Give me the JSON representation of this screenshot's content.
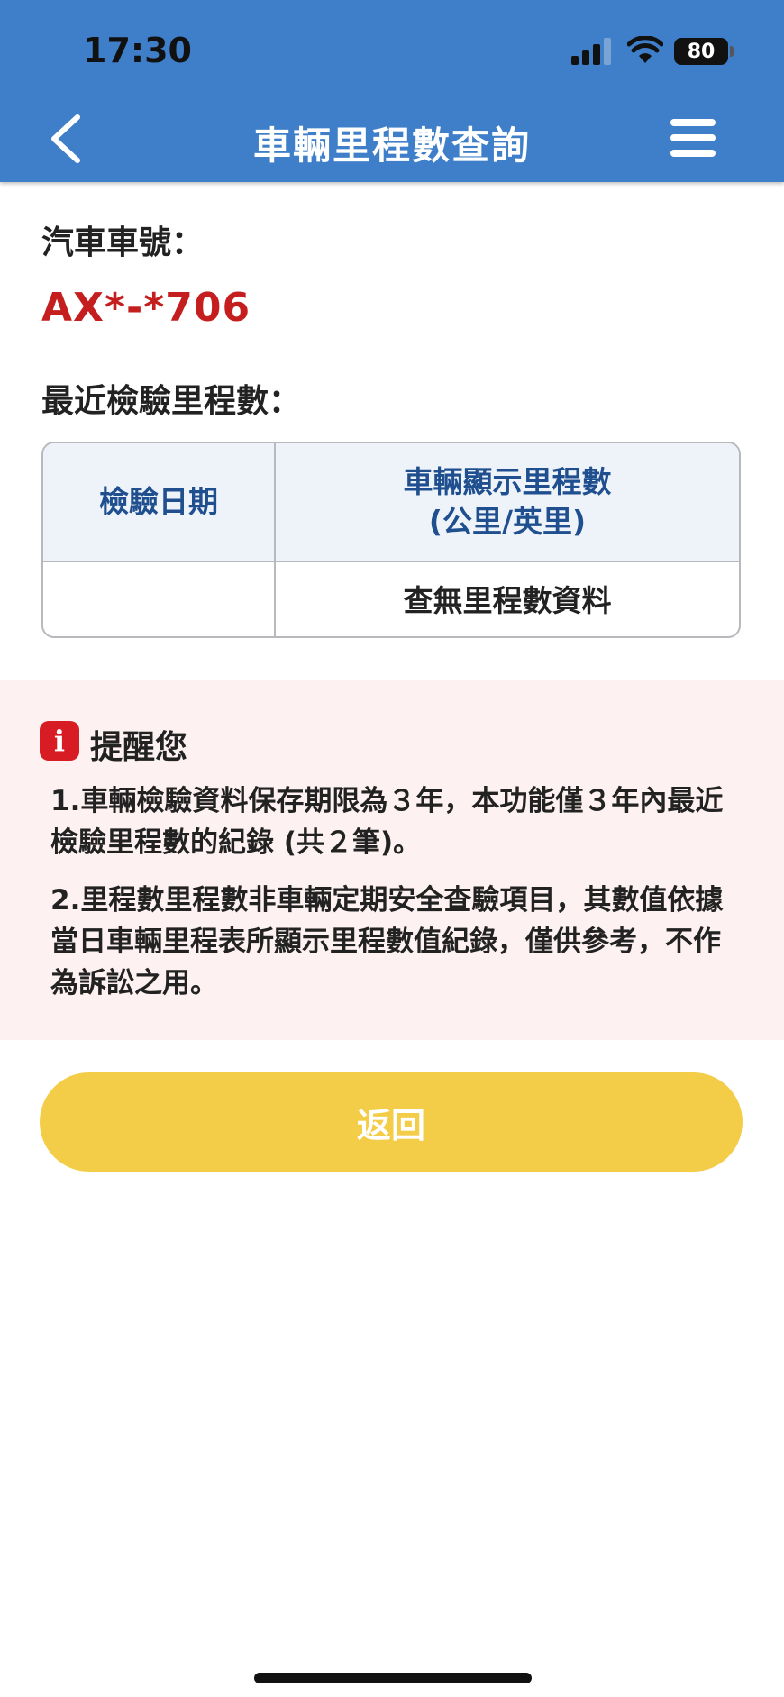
{
  "status_bar": {
    "time": "17:30",
    "battery": "80"
  },
  "header": {
    "title": "車輛里程數查詢"
  },
  "vehicle": {
    "plate_label": "汽車車號：",
    "plate": "AX*-*706"
  },
  "mileage": {
    "section_label": "最近檢驗里程數：",
    "columns": [
      {
        "line1": "檢驗日期"
      },
      {
        "line1": "車輛顯示里程數",
        "line2": "(公里/英里)"
      }
    ],
    "rows": [
      {
        "date": "",
        "mileage": "查無里程數資料"
      }
    ]
  },
  "reminder": {
    "title": "提醒您",
    "notes": [
      "1.車輛檢驗資料保存期限為３年，本功能僅３年內最近檢驗里程數的紀錄 (共２筆)。",
      "2.里程數里程數非車輛定期安全查驗項目，其數值依據當日車輛里程表所顯示里程數值紀錄，僅供參考，不作為訴訟之用。"
    ]
  },
  "actions": {
    "return_label": "返回"
  },
  "colors": {
    "header_bg": "#3f7fc9",
    "plate": "#c41e1e",
    "button": "#f4cd48",
    "reminder_bg": "#fdf1f1"
  }
}
